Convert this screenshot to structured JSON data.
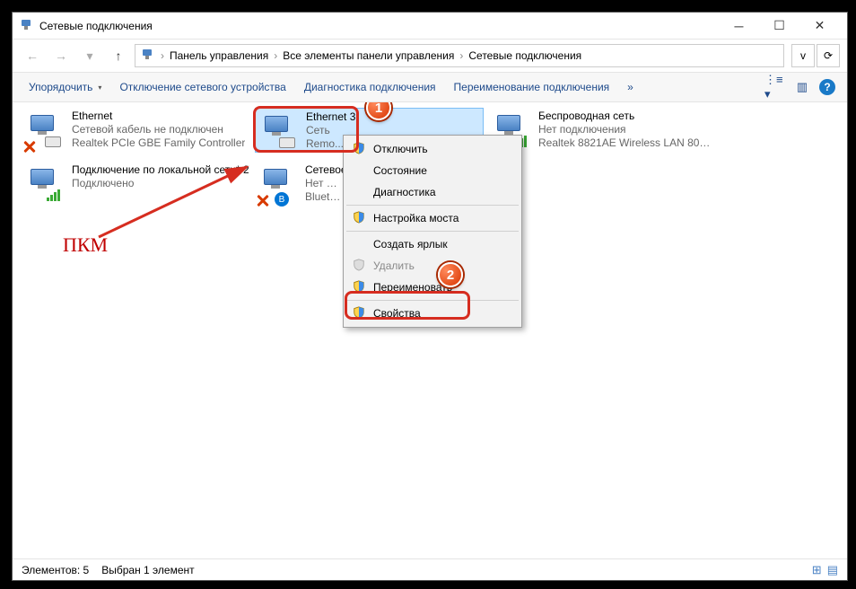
{
  "window": {
    "title": "Сетевые подключения"
  },
  "breadcrumb": {
    "items": [
      "Панель управления",
      "Все элементы панели управления",
      "Сетевые подключения"
    ]
  },
  "toolbar": {
    "organize": "Упорядочить",
    "disable_device": "Отключение сетевого устройства",
    "diagnose": "Диагностика подключения",
    "rename": "Переименование подключения",
    "overflow": "»"
  },
  "connections": [
    {
      "name": "Ethernet",
      "line2": "Сетевой кабель не подключен",
      "line3": "Realtek PCIe GBE Family Controller",
      "type": "wired",
      "error": true
    },
    {
      "name": "Ethernet 3",
      "line2": "Сеть",
      "line3": "Remo...",
      "type": "wired",
      "selected": true
    },
    {
      "name": "Беспроводная сеть",
      "line2": "Нет подключения",
      "line3": "Realtek 8821AE Wireless LAN 802....",
      "type": "wireless"
    },
    {
      "name": "Подключение по локальной сети* 2",
      "line2": "Подключено",
      "line3": "",
      "type": "wireless_ok"
    },
    {
      "name": "Сетевое...",
      "line2": "Нет подключения",
      "line3": "Bluetooth...",
      "type": "bluetooth",
      "error": true
    }
  ],
  "context_menu": {
    "disable": "Отключить",
    "status": "Состояние",
    "diagnose": "Диагностика",
    "bridge": "Настройка моста",
    "shortcut": "Создать ярлык",
    "delete": "Удалить",
    "rename": "Переименовать",
    "properties": "Свойства"
  },
  "annotations": {
    "pkm": "ПКМ",
    "badge1": "1",
    "badge2": "2"
  },
  "statusbar": {
    "count": "Элементов: 5",
    "selected": "Выбран 1 элемент"
  }
}
